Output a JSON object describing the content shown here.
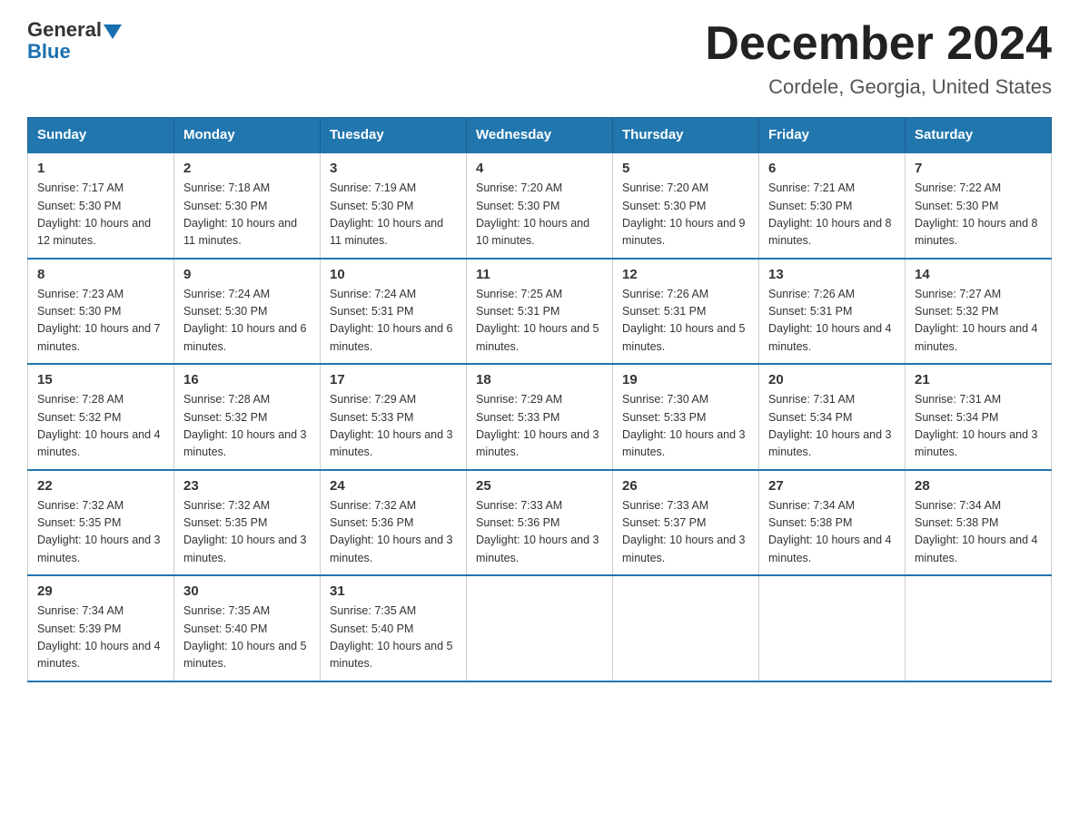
{
  "header": {
    "logo_general": "General",
    "logo_blue": "Blue",
    "calendar_title": "December 2024",
    "calendar_subtitle": "Cordele, Georgia, United States"
  },
  "days_of_week": [
    "Sunday",
    "Monday",
    "Tuesday",
    "Wednesday",
    "Thursday",
    "Friday",
    "Saturday"
  ],
  "weeks": [
    [
      {
        "day": "1",
        "sunrise": "7:17 AM",
        "sunset": "5:30 PM",
        "daylight": "10 hours and 12 minutes."
      },
      {
        "day": "2",
        "sunrise": "7:18 AM",
        "sunset": "5:30 PM",
        "daylight": "10 hours and 11 minutes."
      },
      {
        "day": "3",
        "sunrise": "7:19 AM",
        "sunset": "5:30 PM",
        "daylight": "10 hours and 11 minutes."
      },
      {
        "day": "4",
        "sunrise": "7:20 AM",
        "sunset": "5:30 PM",
        "daylight": "10 hours and 10 minutes."
      },
      {
        "day": "5",
        "sunrise": "7:20 AM",
        "sunset": "5:30 PM",
        "daylight": "10 hours and 9 minutes."
      },
      {
        "day": "6",
        "sunrise": "7:21 AM",
        "sunset": "5:30 PM",
        "daylight": "10 hours and 8 minutes."
      },
      {
        "day": "7",
        "sunrise": "7:22 AM",
        "sunset": "5:30 PM",
        "daylight": "10 hours and 8 minutes."
      }
    ],
    [
      {
        "day": "8",
        "sunrise": "7:23 AM",
        "sunset": "5:30 PM",
        "daylight": "10 hours and 7 minutes."
      },
      {
        "day": "9",
        "sunrise": "7:24 AM",
        "sunset": "5:30 PM",
        "daylight": "10 hours and 6 minutes."
      },
      {
        "day": "10",
        "sunrise": "7:24 AM",
        "sunset": "5:31 PM",
        "daylight": "10 hours and 6 minutes."
      },
      {
        "day": "11",
        "sunrise": "7:25 AM",
        "sunset": "5:31 PM",
        "daylight": "10 hours and 5 minutes."
      },
      {
        "day": "12",
        "sunrise": "7:26 AM",
        "sunset": "5:31 PM",
        "daylight": "10 hours and 5 minutes."
      },
      {
        "day": "13",
        "sunrise": "7:26 AM",
        "sunset": "5:31 PM",
        "daylight": "10 hours and 4 minutes."
      },
      {
        "day": "14",
        "sunrise": "7:27 AM",
        "sunset": "5:32 PM",
        "daylight": "10 hours and 4 minutes."
      }
    ],
    [
      {
        "day": "15",
        "sunrise": "7:28 AM",
        "sunset": "5:32 PM",
        "daylight": "10 hours and 4 minutes."
      },
      {
        "day": "16",
        "sunrise": "7:28 AM",
        "sunset": "5:32 PM",
        "daylight": "10 hours and 3 minutes."
      },
      {
        "day": "17",
        "sunrise": "7:29 AM",
        "sunset": "5:33 PM",
        "daylight": "10 hours and 3 minutes."
      },
      {
        "day": "18",
        "sunrise": "7:29 AM",
        "sunset": "5:33 PM",
        "daylight": "10 hours and 3 minutes."
      },
      {
        "day": "19",
        "sunrise": "7:30 AM",
        "sunset": "5:33 PM",
        "daylight": "10 hours and 3 minutes."
      },
      {
        "day": "20",
        "sunrise": "7:31 AM",
        "sunset": "5:34 PM",
        "daylight": "10 hours and 3 minutes."
      },
      {
        "day": "21",
        "sunrise": "7:31 AM",
        "sunset": "5:34 PM",
        "daylight": "10 hours and 3 minutes."
      }
    ],
    [
      {
        "day": "22",
        "sunrise": "7:32 AM",
        "sunset": "5:35 PM",
        "daylight": "10 hours and 3 minutes."
      },
      {
        "day": "23",
        "sunrise": "7:32 AM",
        "sunset": "5:35 PM",
        "daylight": "10 hours and 3 minutes."
      },
      {
        "day": "24",
        "sunrise": "7:32 AM",
        "sunset": "5:36 PM",
        "daylight": "10 hours and 3 minutes."
      },
      {
        "day": "25",
        "sunrise": "7:33 AM",
        "sunset": "5:36 PM",
        "daylight": "10 hours and 3 minutes."
      },
      {
        "day": "26",
        "sunrise": "7:33 AM",
        "sunset": "5:37 PM",
        "daylight": "10 hours and 3 minutes."
      },
      {
        "day": "27",
        "sunrise": "7:34 AM",
        "sunset": "5:38 PM",
        "daylight": "10 hours and 4 minutes."
      },
      {
        "day": "28",
        "sunrise": "7:34 AM",
        "sunset": "5:38 PM",
        "daylight": "10 hours and 4 minutes."
      }
    ],
    [
      {
        "day": "29",
        "sunrise": "7:34 AM",
        "sunset": "5:39 PM",
        "daylight": "10 hours and 4 minutes."
      },
      {
        "day": "30",
        "sunrise": "7:35 AM",
        "sunset": "5:40 PM",
        "daylight": "10 hours and 5 minutes."
      },
      {
        "day": "31",
        "sunrise": "7:35 AM",
        "sunset": "5:40 PM",
        "daylight": "10 hours and 5 minutes."
      },
      null,
      null,
      null,
      null
    ]
  ]
}
